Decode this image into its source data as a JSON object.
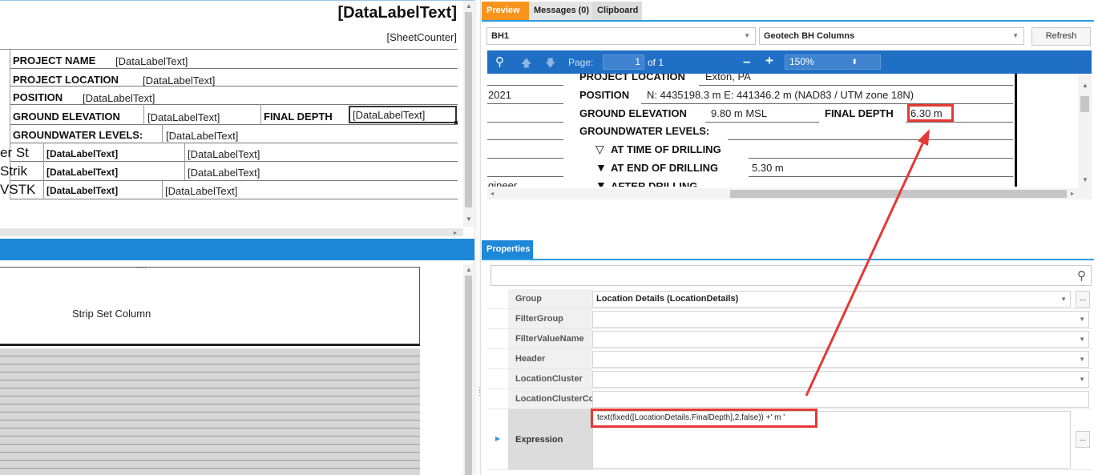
{
  "designer": {
    "title": "[DataLabelText]",
    "sheet_counter": "[SheetCounter]",
    "rows": {
      "project_name": {
        "label": "PROJECT NAME",
        "value": "[DataLabelText]"
      },
      "project_location": {
        "label": "PROJECT LOCATION",
        "value": "[DataLabelText]"
      },
      "position": {
        "label": "POSITION",
        "value": "[DataLabelText]"
      },
      "ground_elevation": {
        "label": "GROUND ELEVATION",
        "value": "[DataLabelText]"
      },
      "final_depth": {
        "label": "FINAL DEPTH",
        "value": "[DataLabelText]"
      },
      "groundwater": {
        "label": "GROUNDWATER LEVELS:",
        "value": "[DataLabelText]"
      },
      "gw1": {
        "prefix": "er St",
        "label": "[DataLabelText]",
        "value": "[DataLabelText]"
      },
      "gw2": {
        "prefix": "Strik",
        "label": "[DataLabelText]",
        "value": "[DataLabelText]"
      },
      "gw3": {
        "prefix": "VSTK",
        "label": "[DataLabelText]",
        "value": "[DataLabelText]"
      }
    }
  },
  "strip": {
    "grip": "....",
    "label": "Strip Set Column"
  },
  "tabs": {
    "preview": "Preview",
    "messages": "Messages (0)",
    "clipboard": "Clipboard"
  },
  "toolbar": {
    "borehole": "BH1",
    "columns": "Geotech BH Columns",
    "refresh": "Refresh",
    "page_label": "Page:",
    "page_value": "1",
    "page_total": "of 1",
    "zoom": "150%"
  },
  "preview": {
    "project_location_label": "PROJECT LOCATION",
    "project_location_value": "Exton, PA",
    "date_fragment": "2021",
    "position_label": "POSITION",
    "position_value": "N: 4435198.3 m E: 441346.2 m (NAD83 / UTM zone 18N)",
    "ground_elevation_label": "GROUND ELEVATION",
    "ground_elevation_value": "9.80 m MSL",
    "final_depth_label": "FINAL DEPTH",
    "final_depth_value": "6.30 m",
    "groundwater_label": "GROUNDWATER LEVELS:",
    "time_of_drilling_label": "AT TIME OF DRILLING",
    "end_of_drilling_label": "AT END OF DRILLING",
    "end_of_drilling_value": "5.30 m",
    "after_drilling_label": "AFTER DRILLING",
    "engineer_fragment": "gineer"
  },
  "properties": {
    "tab": "Properties",
    "rows": [
      {
        "name": "Group",
        "value": "Location Details (LocationDetails)"
      },
      {
        "name": "FilterGroup",
        "value": ""
      },
      {
        "name": "FilterValueName",
        "value": ""
      },
      {
        "name": "Header",
        "value": ""
      },
      {
        "name": "LocationCluster",
        "value": ""
      },
      {
        "name": "LocationClusterCo",
        "value": ""
      }
    ],
    "expression_name": "Expression",
    "expression_value": "text(fixed([LocationDetails.FinalDepth],2,false)) +' m '"
  },
  "colors": {
    "accent": "#2b9be0",
    "preview_tab": "#f7941d",
    "toolbar": "#1f6fc5",
    "highlight": "#e53935"
  }
}
